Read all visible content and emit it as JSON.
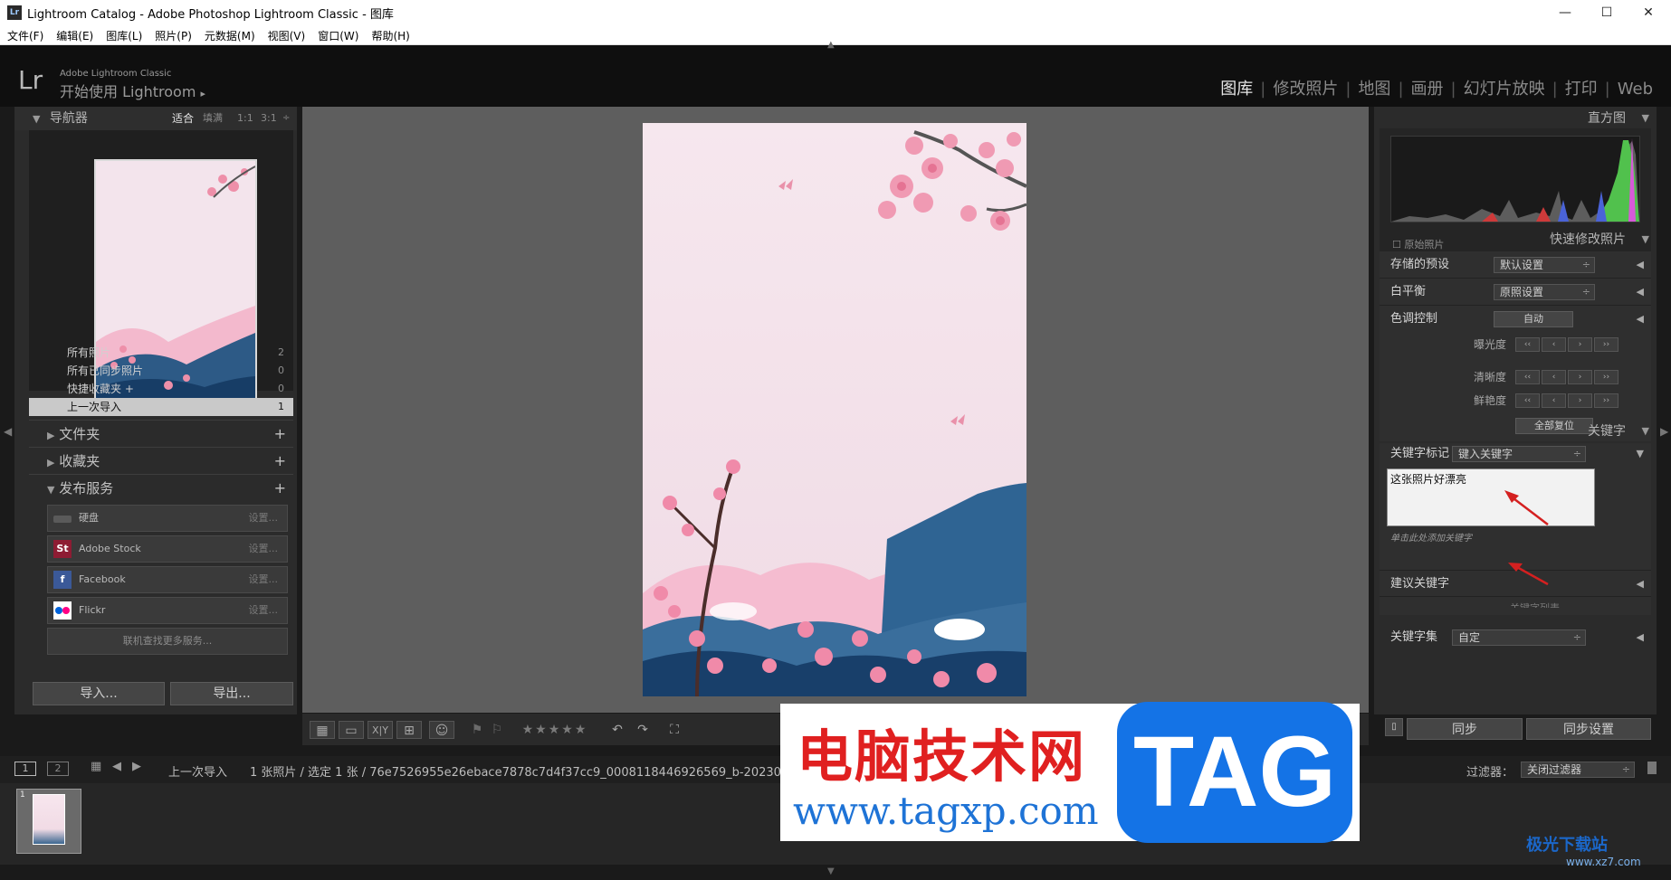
{
  "window": {
    "title": "Lightroom Catalog - Adobe Photoshop Lightroom Classic - 图库",
    "app_icon": "Lr",
    "controls": [
      "—",
      "☐",
      "✕"
    ]
  },
  "menu": [
    "文件(F)",
    "编辑(E)",
    "图库(L)",
    "照片(P)",
    "元数据(M)",
    "视图(V)",
    "窗口(W)",
    "帮助(H)"
  ],
  "identity": {
    "logo": "Lr",
    "small": "Adobe Lightroom Classic",
    "big": "开始使用 Lightroom",
    "arrow": "▸"
  },
  "modules": [
    "图库",
    "修改照片",
    "地图",
    "画册",
    "幻灯片放映",
    "打印",
    "Web"
  ],
  "modules_sep": "|",
  "navigator": {
    "title": "导航器",
    "zoom": [
      "适合",
      "填满",
      "1:1",
      "3:1"
    ],
    "zoom_more": "÷"
  },
  "catalog": [
    {
      "label": "所有照片",
      "count": "2"
    },
    {
      "label": "所有已同步照片",
      "count": "0"
    },
    {
      "label": "快捷收藏夹 +",
      "count": "0"
    },
    {
      "label": "上一次导入",
      "count": "1"
    }
  ],
  "sections": {
    "folders": "文件夹",
    "collections": "收藏夹",
    "publish": "发布服务",
    "plus": "+"
  },
  "publish_services": [
    {
      "name": "硬盘",
      "settings": "设置...",
      "icon": "hard-drive-icon"
    },
    {
      "name": "Adobe Stock",
      "settings": "设置...",
      "icon": "adobe-stock-icon"
    },
    {
      "name": "Facebook",
      "settings": "设置...",
      "icon": "facebook-icon"
    },
    {
      "name": "Flickr",
      "settings": "设置...",
      "icon": "flickr-icon"
    }
  ],
  "find_more": "联机查找更多服务...",
  "import_btn": "导入...",
  "export_btn": "导出...",
  "histogram": {
    "title": "直方图",
    "original": "原始照片"
  },
  "quick_develop": {
    "title": "快速修改照片",
    "saved_preset_label": "存储的预设",
    "saved_preset_value": "默认设置",
    "wb_label": "白平衡",
    "wb_value": "原照设置",
    "tone_label": "色调控制",
    "auto": "自动",
    "exposure": "曝光度",
    "clarity": "清晰度",
    "vibrance": "鲜艳度",
    "reset_all": "全部复位",
    "stepper": [
      "‹‹",
      "‹",
      "›",
      "››"
    ]
  },
  "keywording": {
    "title": "关键字",
    "tags_label": "关键字标记",
    "tags_mode": "键入关键字",
    "text_value": "这张照片好漂亮",
    "hint": "单击此处添加关键字",
    "suggestions": "建议关键字",
    "set_label": "关键字集",
    "set_value": "自定",
    "keyword_list_partial": "关键字列表"
  },
  "sync": {
    "sync": "同步",
    "sync_settings": "同步设置"
  },
  "toolbar_stars": "★★★★★",
  "filmstrip_bar": {
    "page1": "1",
    "page2": "2",
    "source": "上一次导入",
    "info": "1 张照片 / 选定 1 张 / 76e7526955e26ebace7878c7d4f37cc9_0008118446926569_b-20230907170150-x6cpn94.jpg",
    "filter_label": "过滤器：",
    "filter_value": "关闭过滤器"
  },
  "thumb_index": "1",
  "watermark": {
    "site_cn": "电脑技术网",
    "site_url": "www.tagxp.com",
    "tag": "TAG",
    "jg": "极光下载站",
    "jg_url": "www.xz7.com"
  },
  "colors": {
    "accent_red": "#e02020",
    "tag_blue": "#1473e6",
    "arrow_red": "#d42020"
  }
}
